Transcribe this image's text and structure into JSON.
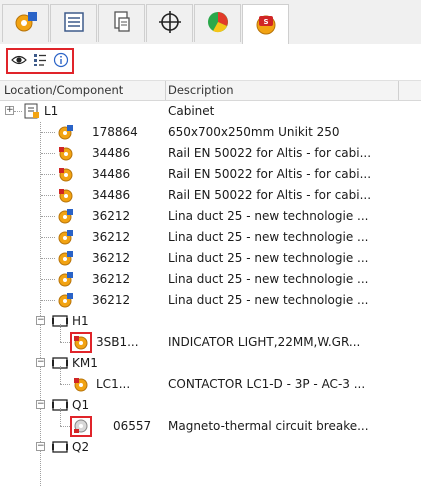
{
  "tabs": [
    {
      "icon": "component-gear-icon"
    },
    {
      "icon": "list-view-icon"
    },
    {
      "icon": "document-tree-icon"
    },
    {
      "icon": "crosshair-icon"
    },
    {
      "icon": "pie-chart-icon"
    },
    {
      "icon": "red-component-icon",
      "active": true
    }
  ],
  "toolbar": {
    "buttons": [
      {
        "icon": "eye-icon"
      },
      {
        "icon": "filter-list-icon"
      },
      {
        "icon": "info-icon"
      }
    ]
  },
  "columns": {
    "location": "Location/Component",
    "description": "Description"
  },
  "rows": [
    {
      "loc": "L1",
      "desc": "Cabinet"
    },
    {
      "loc": "178864",
      "desc": "650x700x250mm Unikit 250"
    },
    {
      "loc": "34486",
      "desc": "Rail EN 50022 for Altis - for cabi..."
    },
    {
      "loc": "34486",
      "desc": "Rail EN 50022 for Altis - for cabi..."
    },
    {
      "loc": "34486",
      "desc": "Rail EN 50022 for Altis - for cabi..."
    },
    {
      "loc": "36212",
      "desc": "Lina duct 25 - new technologie ..."
    },
    {
      "loc": "36212",
      "desc": "Lina duct 25 - new technologie ..."
    },
    {
      "loc": "36212",
      "desc": "Lina duct 25 - new technologie ..."
    },
    {
      "loc": "36212",
      "desc": "Lina duct 25 - new technologie ..."
    },
    {
      "loc": "36212",
      "desc": "Lina duct 25 - new technologie ..."
    },
    {
      "loc": "H1",
      "desc": ""
    },
    {
      "loc": "3SB1...",
      "desc": "INDICATOR LIGHT,22MM,W.GR..."
    },
    {
      "loc": "KM1",
      "desc": ""
    },
    {
      "loc": "LC1...",
      "desc": "CONTACTOR LC1-D - 3P - AC-3 ..."
    },
    {
      "loc": "Q1",
      "desc": ""
    },
    {
      "loc": "06557",
      "desc": "Magneto-thermal circuit breake..."
    },
    {
      "loc": "Q2",
      "desc": ""
    }
  ],
  "colors": {
    "highlight": "#e0242a",
    "gear_orange": "#f2a312",
    "gear_blue": "#2a63c7"
  }
}
